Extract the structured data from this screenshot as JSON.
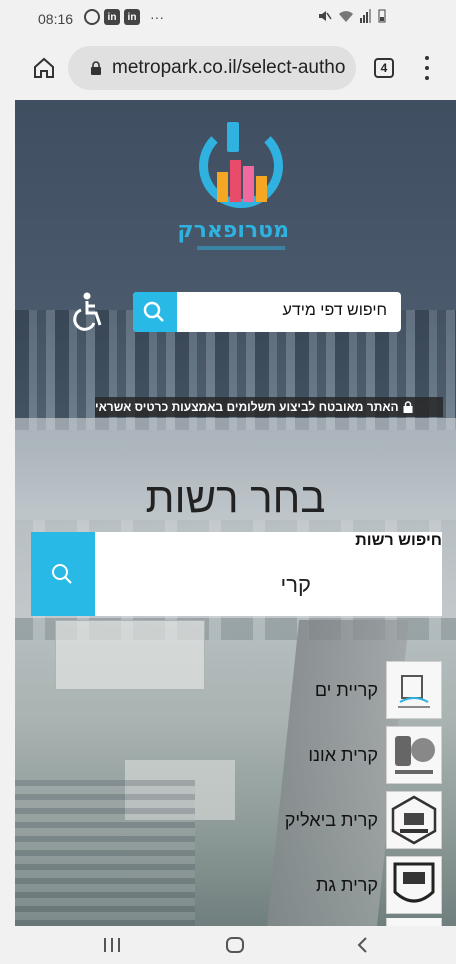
{
  "status_bar": {
    "time": "08:16",
    "left_icons": [
      "whatsapp-icon",
      "linkedin-icon",
      "linkedin-icon"
    ],
    "linkedin_glyph": "in",
    "more": "···",
    "right_icons": [
      "mute-icon",
      "wifi-icon",
      "signal-icon",
      "battery-icon"
    ]
  },
  "browser": {
    "url": "metropark.co.il/select-autho",
    "tab_count": "4"
  },
  "page": {
    "logo_text": "מטרופארק",
    "info_search_label": "חיפוש דפי מידע",
    "secure_notice": "האתר מאובטח לביצוע תשלומים באמצעות כרטיס אשראי",
    "select_title": "בחר רשות",
    "authority_search_label": "חיפוש רשות",
    "authority_search_value": "קרי",
    "results": [
      {
        "name": "קריית ים"
      },
      {
        "name": "קרית אונו"
      },
      {
        "name": "קרית ביאליק"
      },
      {
        "name": "קרית גת"
      }
    ]
  },
  "colors": {
    "accent": "#29b9e6",
    "logo_blue": "#2fb2e0"
  }
}
